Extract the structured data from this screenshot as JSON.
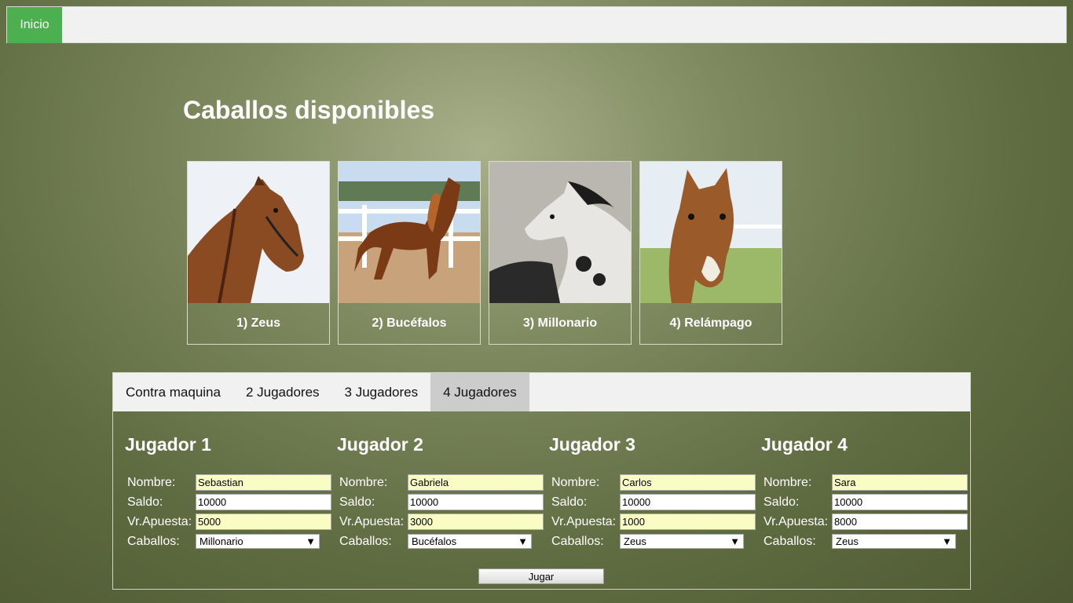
{
  "nav": {
    "home_label": "Inicio"
  },
  "title": "Caballos disponibles",
  "horses": [
    {
      "label": "1) Zeus"
    },
    {
      "label": "2) Bucéfalos"
    },
    {
      "label": "3) Millonario"
    },
    {
      "label": "4) Relámpago"
    }
  ],
  "tabs": [
    {
      "label": "Contra maquina"
    },
    {
      "label": "2 Jugadores"
    },
    {
      "label": "3 Jugadores"
    },
    {
      "label": "4 Jugadores",
      "active": true
    }
  ],
  "field_labels": {
    "name": "Nombre:",
    "balance": "Saldo:",
    "bet": "Vr.Apuesta:",
    "horse": "Caballos:"
  },
  "players": [
    {
      "title": "Jugador 1",
      "name": "Sebastian",
      "balance": "10000",
      "bet": "5000",
      "horse": "Millonario"
    },
    {
      "title": "Jugador 2",
      "name": "Gabriela",
      "balance": "10000",
      "bet": "3000",
      "horse": "Bucéfalos"
    },
    {
      "title": "Jugador 3",
      "name": "Carlos",
      "balance": "10000",
      "bet": "1000",
      "horse": "Zeus"
    },
    {
      "title": "Jugador 4",
      "name": "Sara",
      "balance": "10000",
      "bet": "8000",
      "horse": "Zeus"
    }
  ],
  "play_label": "Jugar",
  "colors": {
    "accent": "#4caf50",
    "input_highlight": "#fafdc3",
    "active_tab": "#cccccc"
  },
  "icons": {
    "dropdown": "dropdown-arrow-icon"
  }
}
